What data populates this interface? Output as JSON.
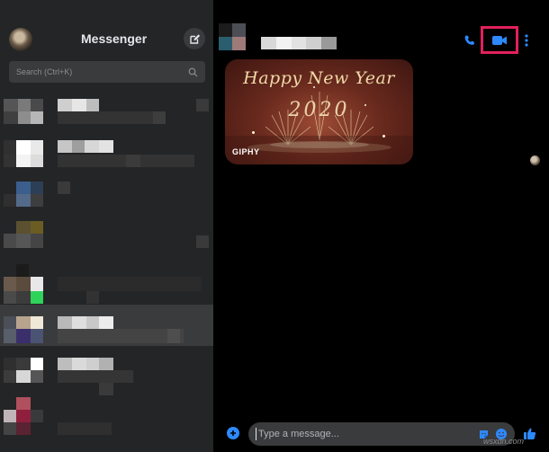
{
  "app": {
    "title": "Messenger",
    "logo_icon": "messenger-logo-icon"
  },
  "window_controls": {
    "minimize_icon": "minimize-icon",
    "maximize_icon": "maximize-icon",
    "close_icon": "close-icon"
  },
  "sidebar": {
    "compose_icon": "compose-icon",
    "search": {
      "placeholder": "Search (Ctrl+K)",
      "icon": "search-icon"
    },
    "conversations": [
      {
        "name": "",
        "preview": "",
        "active": false
      },
      {
        "name": "",
        "preview": "",
        "active": false
      },
      {
        "name": "",
        "preview": "",
        "active": false
      },
      {
        "name": "",
        "preview": "",
        "active": false
      },
      {
        "name": "",
        "preview": "",
        "active": false
      },
      {
        "name": "",
        "preview": "",
        "active": true
      },
      {
        "name": "",
        "preview": "",
        "active": false
      },
      {
        "name": "",
        "preview": "",
        "active": false
      }
    ]
  },
  "chat": {
    "contact_name": "",
    "header_icons": [
      "phone-icon",
      "video-camera-icon",
      "more-options-icon"
    ],
    "highlight_color": "#e2215c",
    "messages": [
      {
        "type": "gif",
        "title": "Happy New Year",
        "year": "2020",
        "label": "GIPHY"
      }
    ],
    "composer": {
      "placeholder": "Type a message...",
      "value": "",
      "icons": [
        "add-icon",
        "sticker-icon",
        "emoji-icon",
        "like-icon"
      ]
    }
  },
  "watermark": "wsxdn.com",
  "colors": {
    "accent": "#2e89ff",
    "sidebar_bg": "#242526",
    "chat_bg": "#000000",
    "input_bg": "#3a3b3c"
  }
}
